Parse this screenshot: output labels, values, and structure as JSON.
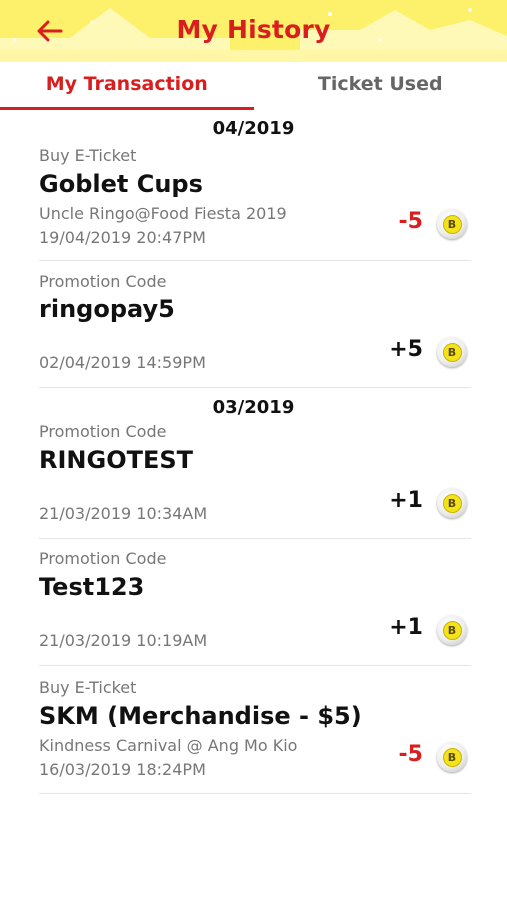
{
  "header": {
    "title": "My History",
    "back_icon": "arrow-left-icon"
  },
  "tabs": [
    {
      "label": "My Transaction",
      "active": true
    },
    {
      "label": "Ticket Used",
      "active": false
    }
  ],
  "colors": {
    "accent": "#d81e1e",
    "header_bg": "#fdf06a",
    "coin": "#f3e21c"
  },
  "groups": [
    {
      "month": "04/2019",
      "items": [
        {
          "type": "Buy E-Ticket",
          "name": "Goblet Cups",
          "sub": "Uncle Ringo@Food Fiesta 2019",
          "date": "19/04/2019 20:47PM",
          "amount": "-5",
          "coin": "B"
        },
        {
          "type": "Promotion Code",
          "name": "ringopay5",
          "sub": "",
          "date": "02/04/2019 14:59PM",
          "amount": "+5",
          "coin": "B"
        }
      ]
    },
    {
      "month": "03/2019",
      "items": [
        {
          "type": "Promotion Code",
          "name": "RINGOTEST",
          "sub": "",
          "date": "21/03/2019 10:34AM",
          "amount": "+1",
          "coin": "B"
        },
        {
          "type": "Promotion Code",
          "name": "Test123",
          "sub": "",
          "date": "21/03/2019 10:19AM",
          "amount": "+1",
          "coin": "B"
        },
        {
          "type": "Buy E-Ticket",
          "name": "SKM (Merchandise - $5)",
          "sub": "Kindness Carnival @ Ang Mo Kio",
          "date": "16/03/2019 18:24PM",
          "amount": "-5",
          "coin": "B"
        }
      ]
    }
  ]
}
